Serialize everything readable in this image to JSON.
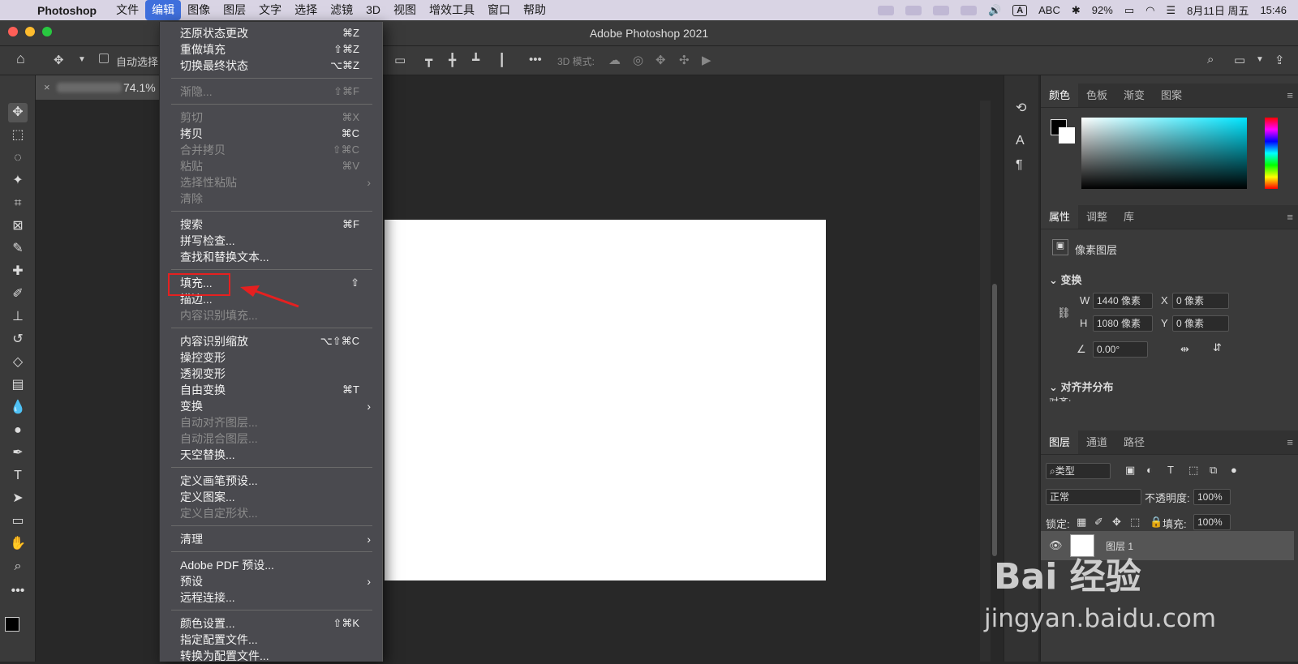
{
  "menubar": {
    "app": "Photoshop",
    "items": [
      "文件",
      "编辑",
      "图像",
      "图层",
      "文字",
      "选择",
      "滤镜",
      "3D",
      "视图",
      "增效工具",
      "窗口",
      "帮助"
    ],
    "active_item": "编辑",
    "input_source": "ABC",
    "battery": "92%",
    "date": "8月11日 周五",
    "time": "15:46"
  },
  "window": {
    "title": "Adobe Photoshop 2021"
  },
  "options_bar": {
    "auto_select": "自动选择",
    "mode_3d": "3D 模式:"
  },
  "document_tab": {
    "zoom": "74.1%"
  },
  "edit_menu": {
    "groups": [
      [
        {
          "label": "还原状态更改",
          "shortcut": "⌘Z",
          "disabled": false
        },
        {
          "label": "重做填充",
          "shortcut": "⇧⌘Z",
          "disabled": false
        },
        {
          "label": "切换最终状态",
          "shortcut": "⌥⌘Z",
          "disabled": false
        }
      ],
      [
        {
          "label": "渐隐...",
          "shortcut": "⇧⌘F",
          "disabled": true
        }
      ],
      [
        {
          "label": "剪切",
          "shortcut": "⌘X",
          "disabled": true
        },
        {
          "label": "拷贝",
          "shortcut": "⌘C",
          "disabled": false
        },
        {
          "label": "合并拷贝",
          "shortcut": "⇧⌘C",
          "disabled": true
        },
        {
          "label": "粘贴",
          "shortcut": "⌘V",
          "disabled": true
        },
        {
          "label": "选择性粘贴",
          "shortcut": "",
          "disabled": true,
          "submenu": true
        },
        {
          "label": "清除",
          "shortcut": "",
          "disabled": true
        }
      ],
      [
        {
          "label": "搜索",
          "shortcut": "⌘F",
          "disabled": false
        },
        {
          "label": "拼写检查...",
          "shortcut": "",
          "disabled": false
        },
        {
          "label": "查找和替换文本...",
          "shortcut": "",
          "disabled": false
        }
      ],
      [
        {
          "label": "填充...",
          "shortcut": "⇧",
          "disabled": false
        },
        {
          "label": "描边...",
          "shortcut": "",
          "disabled": false
        },
        {
          "label": "内容识别填充...",
          "shortcut": "",
          "disabled": true
        }
      ],
      [
        {
          "label": "内容识别缩放",
          "shortcut": "⌥⇧⌘C",
          "disabled": false
        },
        {
          "label": "操控变形",
          "shortcut": "",
          "disabled": false
        },
        {
          "label": "透视变形",
          "shortcut": "",
          "disabled": false
        },
        {
          "label": "自由变换",
          "shortcut": "⌘T",
          "disabled": false
        },
        {
          "label": "变换",
          "shortcut": "",
          "disabled": false,
          "submenu": true
        },
        {
          "label": "自动对齐图层...",
          "shortcut": "",
          "disabled": true
        },
        {
          "label": "自动混合图层...",
          "shortcut": "",
          "disabled": true
        },
        {
          "label": "天空替换...",
          "shortcut": "",
          "disabled": false
        }
      ],
      [
        {
          "label": "定义画笔预设...",
          "shortcut": "",
          "disabled": false
        },
        {
          "label": "定义图案...",
          "shortcut": "",
          "disabled": false
        },
        {
          "label": "定义自定形状...",
          "shortcut": "",
          "disabled": true
        }
      ],
      [
        {
          "label": "清理",
          "shortcut": "",
          "disabled": false,
          "submenu": true
        }
      ],
      [
        {
          "label": "Adobe PDF 预设...",
          "shortcut": "",
          "disabled": false
        },
        {
          "label": "预设",
          "shortcut": "",
          "disabled": false,
          "submenu": true
        },
        {
          "label": "远程连接...",
          "shortcut": "",
          "disabled": false
        }
      ],
      [
        {
          "label": "颜色设置...",
          "shortcut": "⇧⌘K",
          "disabled": false
        },
        {
          "label": "指定配置文件...",
          "shortcut": "",
          "disabled": false
        },
        {
          "label": "转换为配置文件...",
          "shortcut": "",
          "disabled": false
        }
      ]
    ],
    "highlighted_item": "填充..."
  },
  "color_panel": {
    "tabs": [
      "颜色",
      "色板",
      "渐变",
      "图案"
    ],
    "active": "颜色"
  },
  "properties_panel": {
    "tabs": [
      "属性",
      "调整",
      "库"
    ],
    "layer_type": "像素图层",
    "transform_header": "变换",
    "w_label": "W",
    "w": "1440 像素",
    "h_label": "H",
    "h": "1080 像素",
    "x_label": "X",
    "x": "0 像素",
    "y_label": "Y",
    "y": "0 像素",
    "angle": "0.00°",
    "align_header": "对齐并分布",
    "align_sub": "对齐:"
  },
  "layers_panel": {
    "tabs": [
      "图层",
      "通道",
      "路径"
    ],
    "filter": "类型",
    "blend_mode": "正常",
    "opacity_label": "不透明度:",
    "opacity": "100%",
    "lock_label": "锁定:",
    "fill_label": "填充:",
    "fill": "100%",
    "layer_name": "图层 1"
  },
  "watermark": {
    "brand": "Bai 经验",
    "url": "jingyan.baidu.com"
  },
  "colors": {
    "accent": "#3f6fdc",
    "highlight": "#e52020",
    "menu_bg": "#4a4a4f"
  }
}
